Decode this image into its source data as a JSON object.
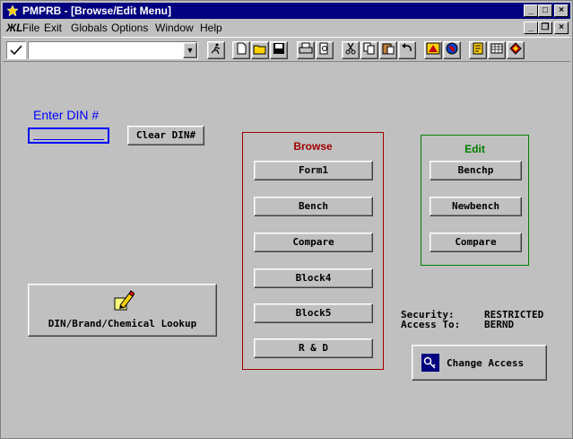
{
  "window": {
    "title": "PMPRB - [Browse/Edit Menu]",
    "controls": {
      "minimize": "_",
      "maximize": "□",
      "close": "×"
    },
    "mdi_controls": {
      "minimize": "_",
      "restore": "❐",
      "close": "×"
    }
  },
  "menu": {
    "items": [
      {
        "label": "File"
      },
      {
        "label": "Exit"
      },
      {
        "label": "Globals"
      },
      {
        "label": "Options"
      },
      {
        "label": "Window"
      },
      {
        "label": "Help"
      }
    ]
  },
  "toolbar": {
    "command_value": "",
    "icons": [
      "checkmark-icon",
      "run-icon",
      "new-icon",
      "open-icon",
      "save-icon",
      "print-icon",
      "print-preview-icon",
      "cut-icon",
      "copy-icon",
      "paste-icon",
      "undo-icon",
      "sas-explorer-icon",
      "globe-icon",
      "notes-icon",
      "table-icon",
      "library-icon"
    ]
  },
  "din": {
    "label": "Enter DIN #",
    "value": "",
    "clear_label": "Clear DIN#"
  },
  "browse": {
    "title": "Browse",
    "buttons": [
      {
        "label": "Form1"
      },
      {
        "label": "Bench"
      },
      {
        "label": "Compare"
      },
      {
        "label": "Block4"
      },
      {
        "label": "Block5"
      },
      {
        "label": "R & D"
      }
    ]
  },
  "edit": {
    "title": "Edit",
    "buttons": [
      {
        "label": "Benchp"
      },
      {
        "label": "Newbench"
      },
      {
        "label": "Compare"
      }
    ]
  },
  "lookup": {
    "label": "DIN/Brand/Chemical Lookup"
  },
  "security": {
    "security_label": "Security:",
    "security_value": "RESTRICTED",
    "access_label": "Access To:",
    "access_value": "BERND"
  },
  "change_access": {
    "label": "Change Access"
  },
  "colors": {
    "title_bar": "#000080",
    "din_label": "#0000ff",
    "browse_title": "#a00000",
    "browse_border": "#a00000",
    "edit_title": "#008000",
    "edit_border": "#008000"
  }
}
